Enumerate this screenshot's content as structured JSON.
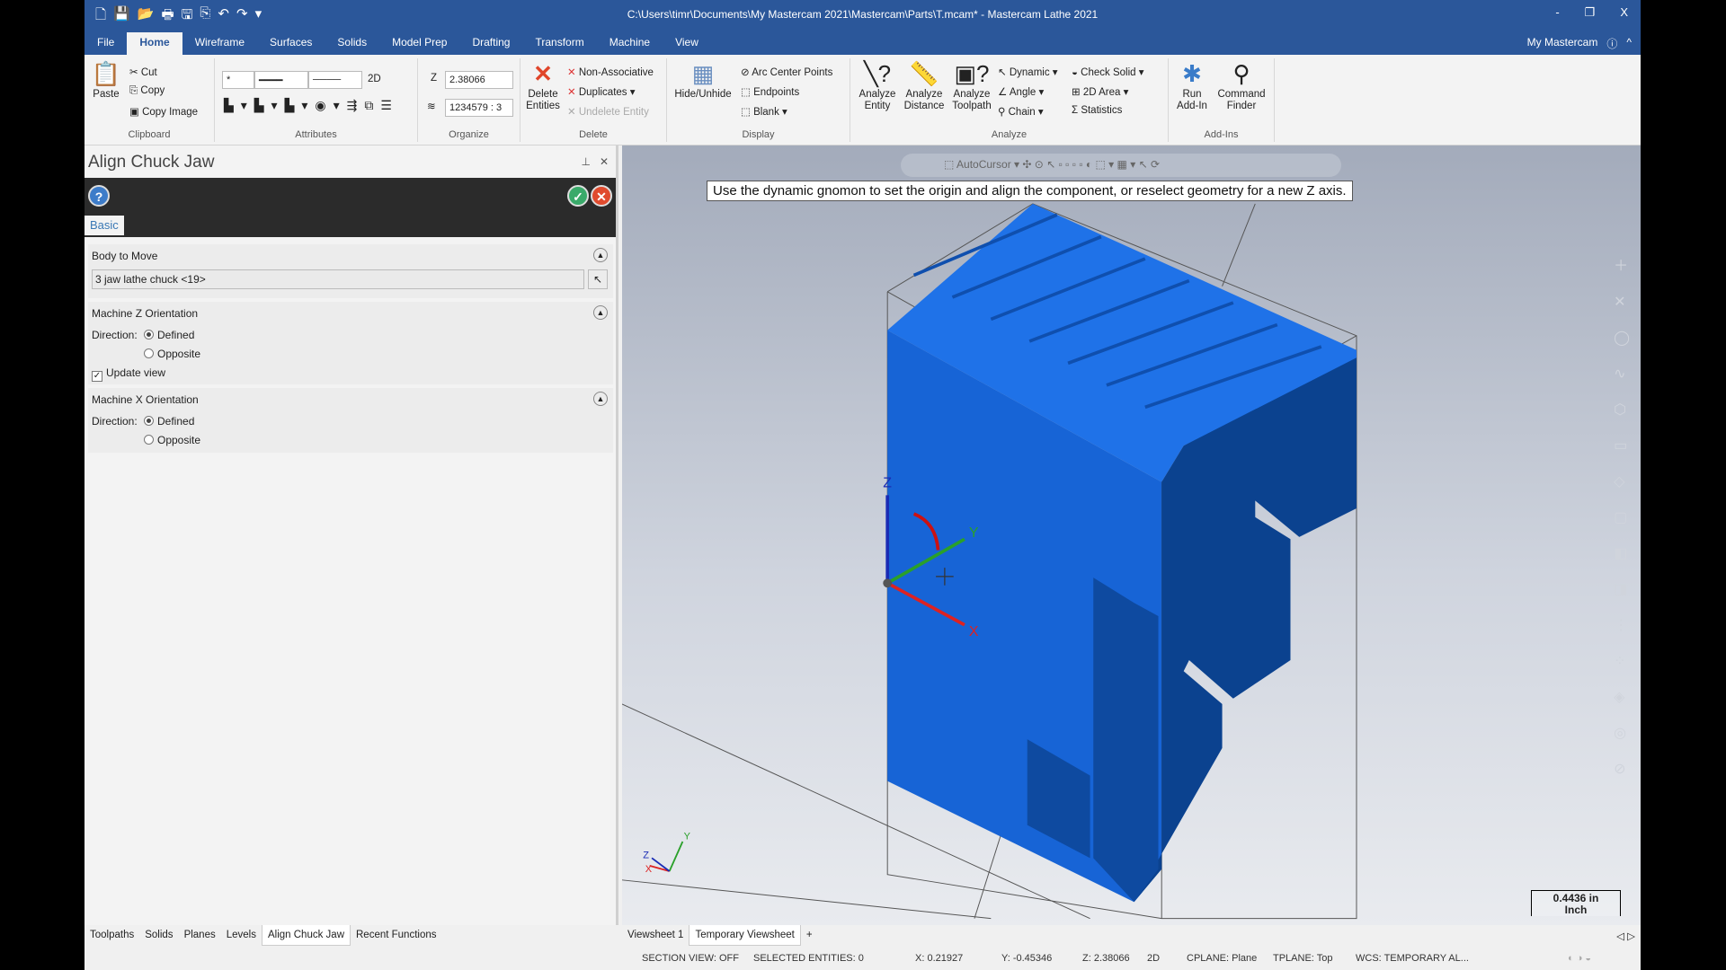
{
  "window": {
    "title": "C:\\Users\\timr\\Documents\\My Mastercam 2021\\Mastercam\\Parts\\T.mcam* - Mastercam Lathe 2021",
    "minimize": "-",
    "restore": "❐",
    "close": "X"
  },
  "qat": [
    "🗋",
    "💾",
    "📂",
    "🖶",
    "🖫",
    "⎘",
    "↶",
    "↷",
    "▾"
  ],
  "tabs": [
    "File",
    "Home",
    "Wireframe",
    "Surfaces",
    "Solids",
    "Model Prep",
    "Drafting",
    "Transform",
    "Machine",
    "View"
  ],
  "my_mastercam": "My Mastercam",
  "ribbon": {
    "clipboard": {
      "label": "Clipboard",
      "paste": "Paste",
      "cut": "Cut",
      "copy": "Copy",
      "copy_image": "Copy Image"
    },
    "attributes": {
      "label": "Attributes",
      "mode": "2D",
      "point_style": "*"
    },
    "organize": {
      "label": "Organize",
      "z_label": "Z",
      "z_value": "2.38066",
      "level_value": "1234579 : 3"
    },
    "delete": {
      "label": "Delete",
      "delete_entities": "Delete Entities",
      "non_associative": "Non-Associative",
      "duplicates": "Duplicates",
      "undelete": "Undelete Entity"
    },
    "display": {
      "label": "Display",
      "hide_unhide": "Hide/Unhide",
      "arc_center": "Arc Center Points",
      "endpoints": "Endpoints",
      "blank": "Blank"
    },
    "analyze": {
      "label": "Analyze",
      "entity": "Analyze Entity",
      "distance": "Analyze Distance",
      "toolpath": "Analyze Toolpath",
      "dynamic": "Dynamic",
      "angle": "Angle",
      "chain": "Chain",
      "check_solid": "Check Solid",
      "area2d": "2D Area",
      "statistics": "Statistics"
    },
    "addins": {
      "label": "Add-Ins",
      "run": "Run Add-In",
      "finder": "Command Finder"
    }
  },
  "panel": {
    "title": "Align Chuck Jaw",
    "tab": "Basic",
    "body": {
      "heading": "Body to Move",
      "value": "3 jaw lathe chuck  <19>"
    },
    "z": {
      "heading": "Machine Z Orientation",
      "direction": "Direction:",
      "defined": "Defined",
      "opposite": "Opposite",
      "selected": "Defined",
      "update_view": "Update view",
      "update_checked": true
    },
    "x": {
      "heading": "Machine X Orientation",
      "direction": "Direction:",
      "defined": "Defined",
      "opposite": "Opposite",
      "selected": "Defined"
    }
  },
  "viewport": {
    "prompt": "Use the dynamic gnomon to set the origin and align the component, or reselect geometry for a new Z axis.",
    "autocursor": "AutoCursor",
    "scale_value": "0.4436 in",
    "scale_unit": "Inch",
    "axis_x": "X",
    "axis_y": "Y",
    "axis_z": "Z",
    "model_color": "#1a66d9"
  },
  "bottom_tabs": [
    "Toolpaths",
    "Solids",
    "Planes",
    "Levels",
    "Align Chuck Jaw",
    "Recent Functions"
  ],
  "active_bottom_tab": "Align Chuck Jaw",
  "viewsheets": [
    "Viewsheet 1",
    "Temporary Viewsheet",
    "+"
  ],
  "status": {
    "section": "SECTION VIEW: OFF",
    "selected": "SELECTED ENTITIES: 0",
    "x": "X:  0.21927",
    "y": "Y:  -0.45346",
    "z": "Z:  2.38066",
    "mode": "2D",
    "cplane": "CPLANE: Plane",
    "tplane": "TPLANE: Top",
    "wcs": "WCS: TEMPORARY AL..."
  },
  "colors": {
    "titlebar": "#2b579a",
    "ok": "#3aaa6a",
    "cancel": "#e04b2e",
    "help": "#3d7cc9"
  }
}
